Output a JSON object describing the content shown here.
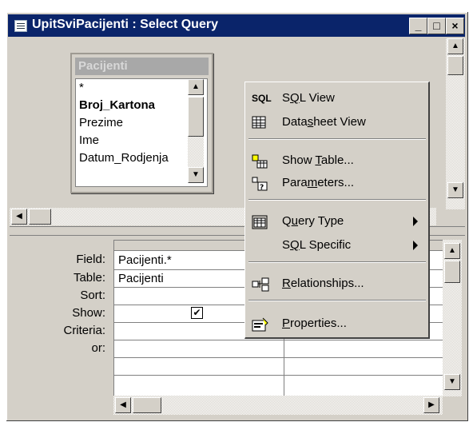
{
  "window": {
    "title": "UpitSviPacijenti : Select Query",
    "minimize_label": "_",
    "maximize_label": "□",
    "close_label": "×"
  },
  "field_list": {
    "table_name": "Pacijenti",
    "fields": [
      "*",
      "Broj_Kartona",
      "Prezime",
      "Ime",
      "Datum_Rodjenja"
    ]
  },
  "design_grid": {
    "row_labels": [
      "Field:",
      "Table:",
      "Sort:",
      "Show:",
      "Criteria:",
      "or:"
    ],
    "columns": [
      {
        "field": "Pacijenti.*",
        "table": "Pacijenti",
        "show": true
      }
    ]
  },
  "context_menu": {
    "items": [
      {
        "id": "sql-view",
        "icon": "sql-icon",
        "pre": "S",
        "ul": "Q",
        "post": "L View",
        "submenu": false
      },
      {
        "id": "datasheet-view",
        "icon": "datasheet-icon",
        "pre": "Data",
        "ul": "s",
        "post": "heet View",
        "submenu": false
      },
      {
        "id": "show-table",
        "icon": "show-table-icon",
        "pre": "Show ",
        "ul": "T",
        "post": "able...",
        "submenu": false
      },
      {
        "id": "parameters",
        "icon": "parameters-icon",
        "pre": "Para",
        "ul": "m",
        "post": "eters...",
        "submenu": false
      },
      {
        "id": "query-type",
        "icon": "query-type-icon",
        "pre": "Q",
        "ul": "u",
        "post": "ery Type",
        "submenu": true
      },
      {
        "id": "sql-specific",
        "icon": "",
        "pre": "S",
        "ul": "Q",
        "post": "L Specific",
        "submenu": true
      },
      {
        "id": "relationships",
        "icon": "relationships-icon",
        "pre": "",
        "ul": "R",
        "post": "elationships...",
        "submenu": false
      },
      {
        "id": "properties",
        "icon": "properties-icon",
        "pre": "",
        "ul": "P",
        "post": "roperties...",
        "submenu": false
      }
    ],
    "sql_icon_text": "SQL"
  }
}
